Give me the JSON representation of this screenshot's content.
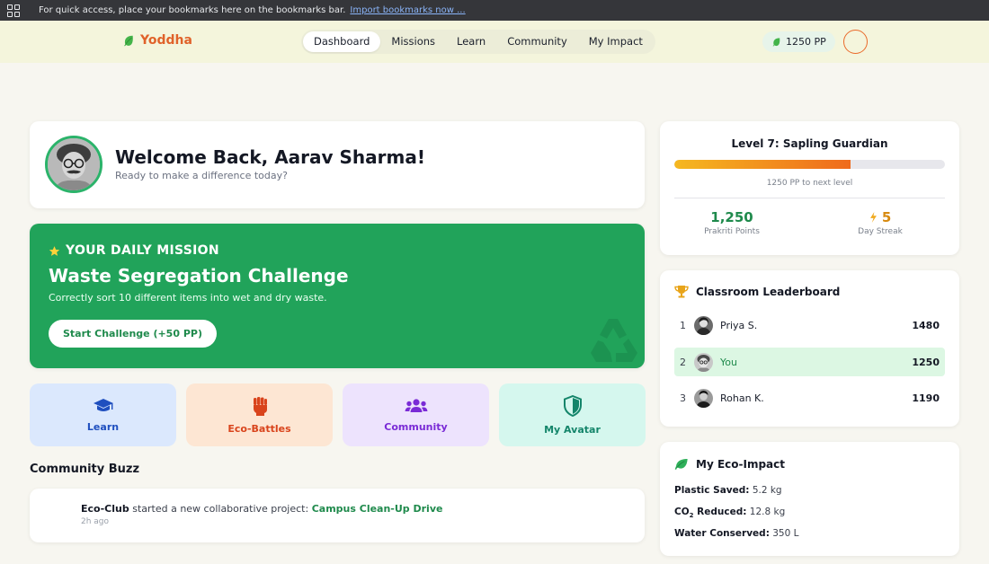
{
  "bookmarks_bar": {
    "message": "For quick access, place your bookmarks here on the bookmarks bar.",
    "import_link": "Import bookmarks now ..."
  },
  "header": {
    "brand": "Yoddha",
    "nav": [
      "Dashboard",
      "Missions",
      "Learn",
      "Community",
      "My Impact"
    ],
    "active_nav": "Dashboard",
    "points_badge": "1250 PP"
  },
  "welcome": {
    "title": "Welcome Back, Aarav Sharma!",
    "subtitle": "Ready to make a difference today?"
  },
  "mission": {
    "eyebrow": "YOUR DAILY MISSION",
    "title": "Waste Segregation Challenge",
    "description": "Correctly sort 10 different items into wet and dry waste.",
    "button": "Start Challenge (+50 PP)"
  },
  "tiles": [
    {
      "label": "Learn",
      "icon": "graduation-cap-icon",
      "bg": "#dbe8fd",
      "color": "#1f4fbf"
    },
    {
      "label": "Eco-Battles",
      "icon": "raised-fist-icon",
      "bg": "#fde6d3",
      "color": "#d9441c"
    },
    {
      "label": "Community",
      "icon": "users-icon",
      "bg": "#ede3fd",
      "color": "#7a2bd6"
    },
    {
      "label": "My Avatar",
      "icon": "shield-icon",
      "bg": "#d5f7ee",
      "color": "#14856a"
    }
  ],
  "community_buzz": {
    "heading": "Community Buzz",
    "items": [
      {
        "actor": "Eco-Club",
        "action": "started a new collaborative project:",
        "project": "Campus Clean-Up Drive",
        "time": "2h ago"
      }
    ]
  },
  "level": {
    "title": "Level 7: Sapling Guardian",
    "progress_fraction": 0.65,
    "next_text": "1250 PP to next level",
    "points_value": "1,250",
    "points_label": "Prakriti Points",
    "streak_value": "5",
    "streak_label": "Day Streak"
  },
  "leaderboard": {
    "title": "Classroom Leaderboard",
    "rows": [
      {
        "rank": "1",
        "name": "Priya S.",
        "score": "1480"
      },
      {
        "rank": "2",
        "name": "You",
        "score": "1250"
      },
      {
        "rank": "3",
        "name": "Rohan K.",
        "score": "1190"
      }
    ]
  },
  "eco_impact": {
    "title": "My Eco-Impact",
    "plastic_label": "Plastic Saved:",
    "plastic_value": "5.2 kg",
    "co2_label_main": "CO",
    "co2_label_sub": "2",
    "co2_label_rest": "Reduced:",
    "co2_value": "12.8 kg",
    "water_label": "Water Conserved:",
    "water_value": "350 L"
  },
  "colors": {
    "brand_orange": "#e0622a",
    "mission_green": "#21a35a",
    "accent_green": "#1f8a4c",
    "streak_orange": "#d78a10"
  }
}
